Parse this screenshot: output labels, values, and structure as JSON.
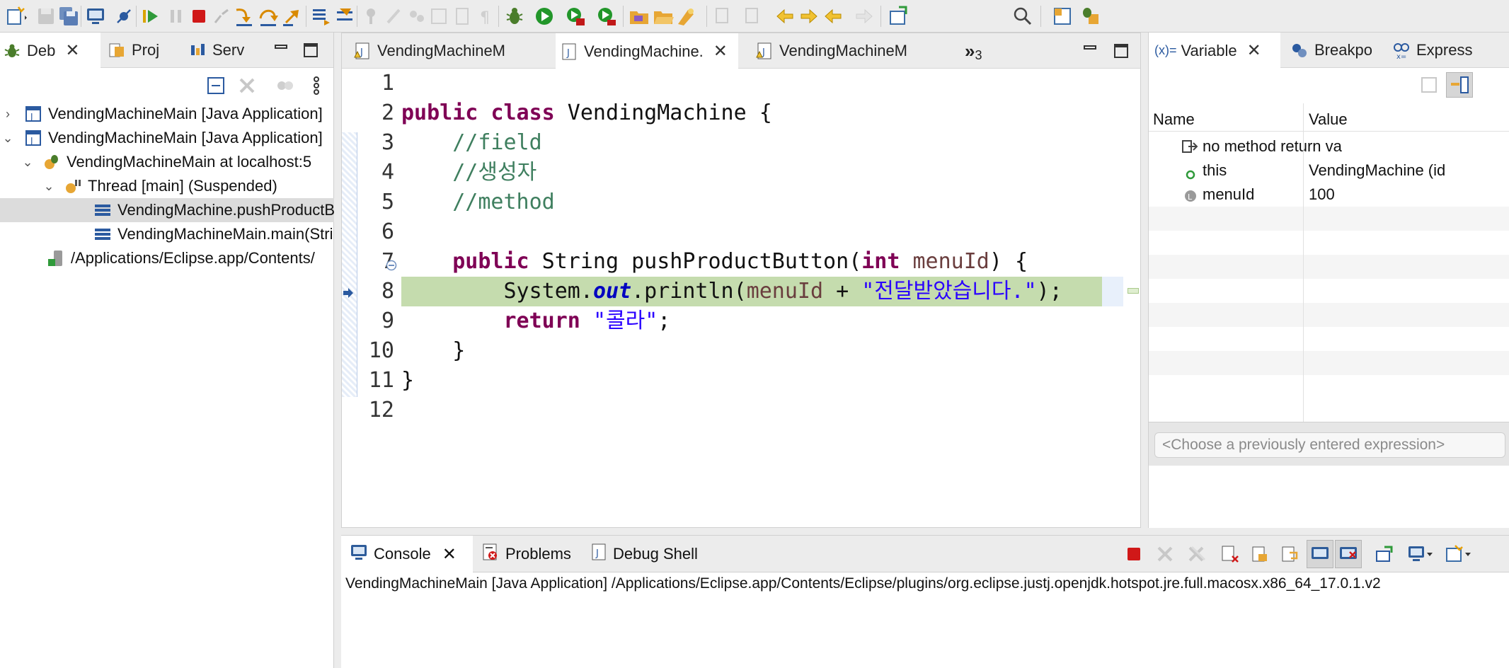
{
  "toolbar": {
    "icons": [
      "new-wizard-icon",
      "save-icon",
      "save-all-icon",
      "terminal-icon",
      "skip-breakpoints-icon",
      "resume-icon",
      "suspend-icon",
      "terminate-icon",
      "disconnect-icon",
      "step-into-icon",
      "step-over-icon",
      "step-return-icon",
      "drop-to-frame-icon",
      "use-step-filters-icon",
      "pin-icon",
      "eraser-icon",
      "toggle-mark-icon",
      "show-whitespace-icon",
      "debug-icon",
      "run-icon",
      "coverage-icon",
      "external-tools-icon",
      "new-package-icon",
      "open-folder-icon",
      "open-task-icon",
      "git-icon",
      "next-annotation-icon",
      "prev-annotation-icon",
      "last-edit-icon",
      "back-icon",
      "forward-icon",
      "open-perspective-icon",
      "search-icon",
      "perspective-icon",
      "debug-perspective-icon"
    ]
  },
  "debug_view": {
    "tabs": [
      {
        "label": "Deb",
        "icon": "bug-icon"
      },
      {
        "label": "Proj",
        "icon": "project-icon"
      },
      {
        "label": "Serv",
        "icon": "server-icon"
      }
    ],
    "tree": [
      {
        "label": "VendingMachineMain [Java Application]",
        "twisty": "›",
        "icon": "java-app-icon"
      },
      {
        "label": "VendingMachineMain [Java Application]",
        "twisty": "⌄",
        "icon": "java-app-icon"
      },
      {
        "label": "VendingMachineMain at localhost:5",
        "twisty": "⌄",
        "icon": "debug-target-icon"
      },
      {
        "label": "Thread [main] (Suspended)",
        "twisty": "⌄",
        "icon": "thread-icon"
      },
      {
        "label": "VendingMachine.pushProductButton",
        "twisty": "",
        "icon": "stack-frame-icon"
      },
      {
        "label": "VendingMachineMain.main(String[])",
        "twisty": "",
        "icon": "stack-frame-icon"
      },
      {
        "label": "/Applications/Eclipse.app/Contents/",
        "twisty": "",
        "icon": "process-icon"
      }
    ]
  },
  "editor": {
    "tabs": [
      {
        "label": "VendingMachineM",
        "icon": "java-file-icon"
      },
      {
        "label": "VendingMachine.",
        "icon": "java-file-icon"
      },
      {
        "label": "VendingMachineM",
        "icon": "java-file-icon"
      }
    ],
    "overflow_label": "»",
    "overflow_count": "3",
    "line_numbers": [
      "1",
      "2",
      "3",
      "4",
      "5",
      "6",
      "7",
      "8",
      "9",
      "10",
      "11",
      "12"
    ],
    "code": {
      "l2_kw1": "public",
      "l2_kw2": "class",
      "l2_rest": " VendingMachine {",
      "l3": "//field",
      "l4": "//생성자",
      "l5": "//method",
      "l7_kw1": "public",
      "l7_mid": " String pushProductButton(",
      "l7_kw2": "int",
      "l7_var": "menuId",
      "l7_end": ") {",
      "l8_a": "System.",
      "l8_field": "out",
      "l8_b": ".println(",
      "l8_var": "menuId",
      "l8_c": " + ",
      "l8_str": "\"전달받았습니다.\"",
      "l8_d": ");",
      "l9_kw": "return",
      "l9_str": "\"콜라\"",
      "l9_end": ";",
      "l10": "}",
      "l11": "}"
    }
  },
  "variables_view": {
    "tabs": [
      {
        "label": "Variable",
        "prefix": "(x)=",
        "icon": "variables-icon"
      },
      {
        "label": "Breakpo",
        "icon": "breakpoints-icon"
      },
      {
        "label": "Express",
        "icon": "expressions-icon"
      }
    ],
    "columns": [
      "Name",
      "Value"
    ],
    "rows": [
      {
        "name": "no method return va",
        "value": "",
        "icon": "return-value-icon"
      },
      {
        "name": "this",
        "value": "VendingMachine  (id",
        "icon": "field-icon"
      },
      {
        "name": "menuId",
        "value": "100",
        "icon": "local-variable-icon"
      }
    ],
    "expression_placeholder": "<Choose a previously entered expression>"
  },
  "console_view": {
    "tabs": [
      {
        "label": "Console",
        "icon": "console-icon"
      },
      {
        "label": "Problems",
        "icon": "problems-icon"
      },
      {
        "label": "Debug Shell",
        "icon": "debug-shell-icon"
      }
    ],
    "header": "VendingMachineMain [Java Application] /Applications/Eclipse.app/Contents/Eclipse/plugins/org.eclipse.justj.openjdk.hotspot.jre.full.macosx.x86_64_17.0.1.v2"
  },
  "colors": {
    "keyword": "#7f0055",
    "comment": "#3f7f5f",
    "string": "#2a00ff",
    "static_field": "#0000c0",
    "current_line": "#c5dcae",
    "selection": "#dcdcdc"
  }
}
